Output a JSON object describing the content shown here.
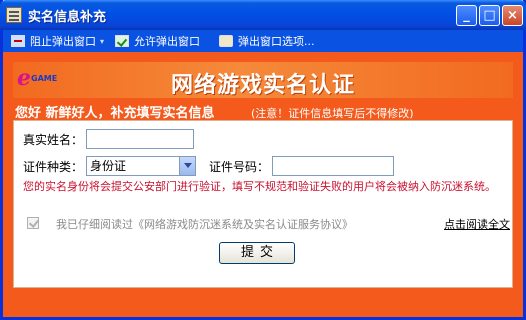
{
  "window": {
    "title": "实名信息补充"
  },
  "toolbar": {
    "block_popup": "阻止弹出窗口",
    "allow_popup": "允许弹出窗口",
    "popup_options": "弹出窗口选项..."
  },
  "banner": {
    "logo_text": "e",
    "logo_subtext": "GAME",
    "title": "网络游戏实名认证"
  },
  "greeting": "您好 新鲜好人，补充填写实名信息",
  "notice": "(注意！证件信息填写后不得修改)",
  "form": {
    "name_label": "真实姓名：",
    "name_value": "",
    "id_type_label": "证件种类：",
    "id_type_value": "身份证",
    "id_number_label": "证件号码：",
    "id_number_value": ""
  },
  "warning": "您的实名身份将会提交公安部门进行验证，填写不规范和验证失败的用户将会被纳入防沉迷系统。",
  "agreement": {
    "checked": true,
    "text": "我已仔细阅读过《网络游戏防沉迷系统及实名认证服务协议》",
    "link": "点击阅读全文"
  },
  "submit_label": "提交"
}
